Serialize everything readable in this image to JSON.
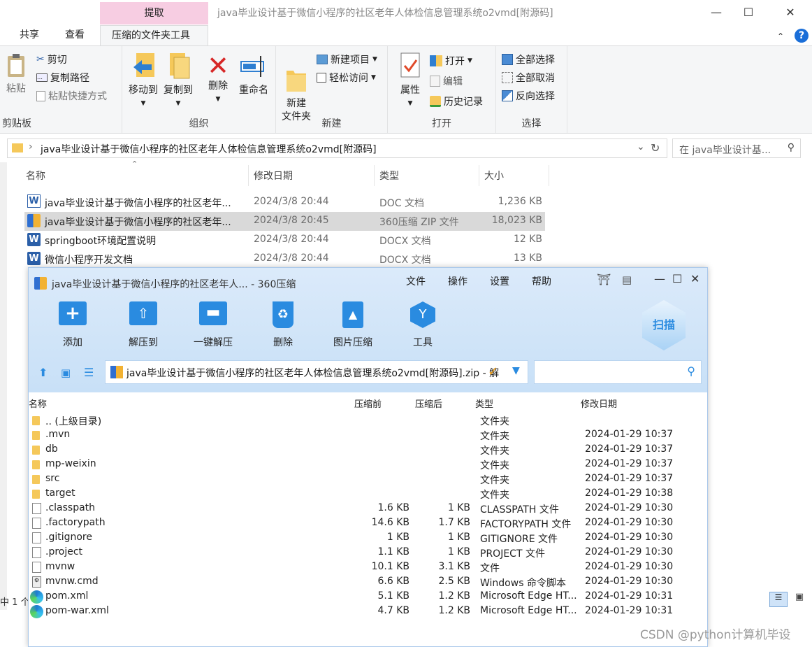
{
  "explorer": {
    "context_tab": "提取",
    "window_title": "java毕业设计基于微信小程序的社区老年人体检信息管理系统o2vmd[附源码]",
    "tabs": [
      "共享",
      "查看",
      "压缩的文件夹工具"
    ],
    "ribbon": {
      "paste": "粘贴",
      "cut": "剪切",
      "copy_path": "复制路径",
      "paste_shortcut": "粘贴快捷方式",
      "clipboard": "剪贴板",
      "move_to": "移动到",
      "copy_to": "复制到",
      "delete": "删除",
      "rename": "重命名",
      "organize": "组织",
      "new_folder": "新建\n文件夹",
      "new_item": "新建项目",
      "easy_access": "轻松访问",
      "new": "新建",
      "properties": "属性",
      "open": "打开",
      "edit": "编辑",
      "history": "历史记录",
      "open_group": "打开",
      "select_all": "全部选择",
      "select_none": "全部取消",
      "invert": "反向选择",
      "select": "选择"
    },
    "address": "java毕业设计基于微信小程序的社区老年人体检信息管理系统o2vmd[附源码]",
    "search_placeholder": "在 java毕业设计基...",
    "columns": [
      "名称",
      "修改日期",
      "类型",
      "大小"
    ],
    "files": [
      {
        "name": "java毕业设计基于微信小程序的社区老年...",
        "date": "2024/3/8 20:44",
        "type": "DOC 文档",
        "size": "1,236 KB",
        "icon": "word-icon"
      },
      {
        "name": "java毕业设计基于微信小程序的社区老年...",
        "date": "2024/3/8 20:45",
        "type": "360压缩 ZIP 文件",
        "size": "18,023 KB",
        "icon": "zip-icon"
      },
      {
        "name": "springboot环境配置说明",
        "date": "2024/3/8 20:44",
        "type": "DOCX 文档",
        "size": "12 KB",
        "icon": "word-icon"
      },
      {
        "name": "微信小程序开发文档",
        "date": "2024/3/8 20:44",
        "type": "DOCX 文档",
        "size": "13 KB",
        "icon": "word-icon"
      }
    ],
    "status": "中 1 个"
  },
  "zip": {
    "title": "java毕业设计基于微信小程序的社区老年人... - 360压缩",
    "menu": [
      "文件",
      "操作",
      "设置",
      "帮助"
    ],
    "tools": [
      "添加",
      "解压到",
      "一键解压",
      "删除",
      "图片压缩",
      "工具"
    ],
    "scan": "扫描",
    "path": "java毕业设计基于微信小程序的社区老年人体检信息管理系统o2vmd[附源码].zip - 解",
    "columns": [
      "名称",
      "压缩前",
      "压缩后",
      "类型",
      "修改日期"
    ],
    "rows": [
      {
        "name": ".. (上级目录)",
        "before": "",
        "after": "",
        "type": "文件夹",
        "date": "",
        "icon": "folder-icon"
      },
      {
        "name": ".mvn",
        "before": "",
        "after": "",
        "type": "文件夹",
        "date": "2024-01-29 10:37",
        "icon": "folder-icon"
      },
      {
        "name": "db",
        "before": "",
        "after": "",
        "type": "文件夹",
        "date": "2024-01-29 10:37",
        "icon": "folder-icon"
      },
      {
        "name": "mp-weixin",
        "before": "",
        "after": "",
        "type": "文件夹",
        "date": "2024-01-29 10:37",
        "icon": "folder-icon"
      },
      {
        "name": "src",
        "before": "",
        "after": "",
        "type": "文件夹",
        "date": "2024-01-29 10:37",
        "icon": "folder-icon"
      },
      {
        "name": "target",
        "before": "",
        "after": "",
        "type": "文件夹",
        "date": "2024-01-29 10:38",
        "icon": "folder-icon"
      },
      {
        "name": ".classpath",
        "before": "1.6 KB",
        "after": "1 KB",
        "type": "CLASSPATH 文件",
        "date": "2024-01-29 10:30",
        "icon": "file-icon"
      },
      {
        "name": ".factorypath",
        "before": "14.6 KB",
        "after": "1.7 KB",
        "type": "FACTORYPATH 文件",
        "date": "2024-01-29 10:30",
        "icon": "file-icon"
      },
      {
        "name": ".gitignore",
        "before": "1 KB",
        "after": "1 KB",
        "type": "GITIGNORE 文件",
        "date": "2024-01-29 10:30",
        "icon": "file-icon"
      },
      {
        "name": ".project",
        "before": "1.1 KB",
        "after": "1 KB",
        "type": "PROJECT 文件",
        "date": "2024-01-29 10:30",
        "icon": "file-icon"
      },
      {
        "name": "mvnw",
        "before": "10.1 KB",
        "after": "3.1 KB",
        "type": "文件",
        "date": "2024-01-29 10:30",
        "icon": "file-icon"
      },
      {
        "name": "mvnw.cmd",
        "before": "6.6 KB",
        "after": "2.5 KB",
        "type": "Windows 命令脚本",
        "date": "2024-01-29 10:30",
        "icon": "script-icon"
      },
      {
        "name": "pom.xml",
        "before": "5.1 KB",
        "after": "1.2 KB",
        "type": "Microsoft Edge HT...",
        "date": "2024-01-29 10:31",
        "icon": "edge-icon"
      },
      {
        "name": "pom-war.xml",
        "before": "4.7 KB",
        "after": "1.2 KB",
        "type": "Microsoft Edge HT...",
        "date": "2024-01-29 10:31",
        "icon": "edge-icon"
      }
    ]
  },
  "watermark": "CSDN @python计算机毕设"
}
